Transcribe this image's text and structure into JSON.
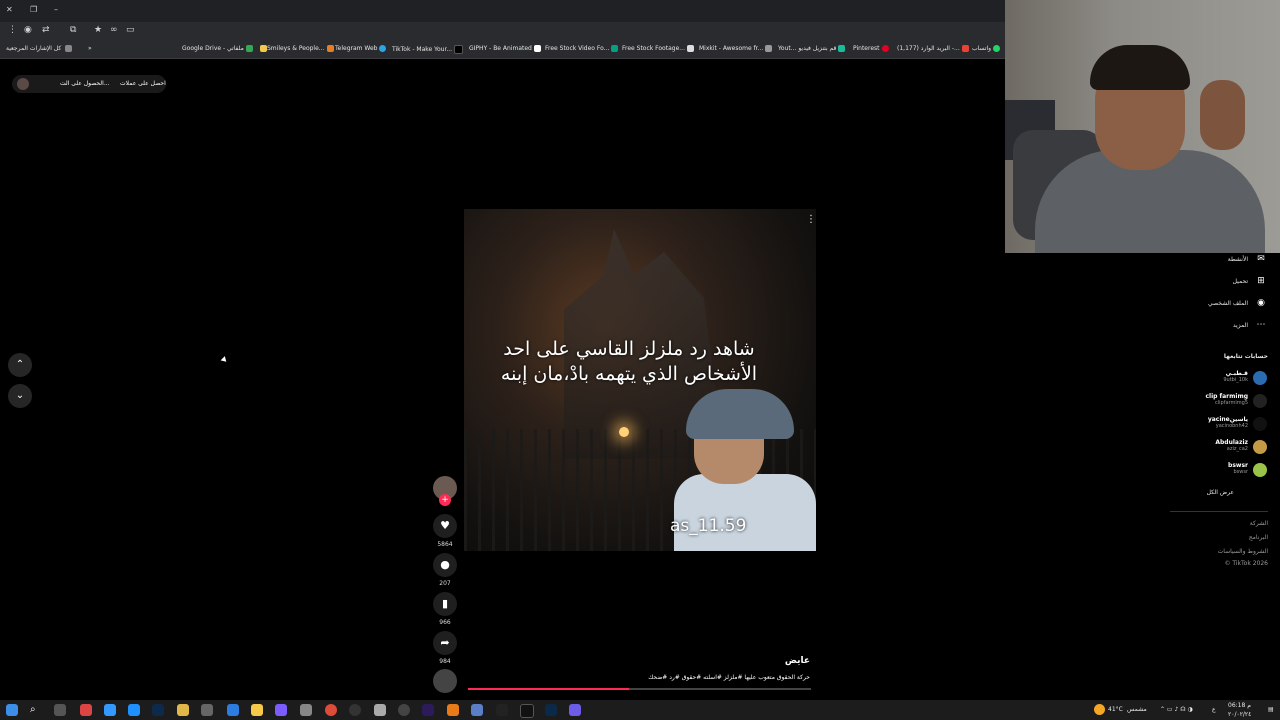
{
  "browser": {
    "bookmarks_all": "كل الإشارات المرجعية",
    "bookmarks": [
      "Google Drive - ملفاتي",
      "Smileys & People...",
      "Telegram Web",
      "TikTok - Make Your...",
      "GIPHY - Be Animated",
      "Free Stock Video Fo...",
      "Free Stock Footage...",
      "Mixkit - Awesome fr...",
      "Yout... قم بتنزيل فيديو",
      "Pinterest",
      "(1,177) البريد الوارد -...",
      "واتساب"
    ]
  },
  "promo": {
    "get_coins": "احصل على عملات",
    "get_app": "الحصول على الت..."
  },
  "video": {
    "overlay_text": "شاهد رد ملزلز القاسي على احد الأشخاص الذي يتهمه بادْ،مان إبنه",
    "tag": "as_11.59",
    "author": "عايض",
    "description": "حركة الحقوق متعوب عليها #ملزلز #اسلته #حقوق #رد #ضحك",
    "likes": "5864",
    "comments": "207",
    "saves": "966",
    "shares": "984",
    "progress": 0.47
  },
  "sidebar": {
    "activity": "الأنشطة",
    "upload": "تحميل",
    "profile": "الملف الشخصي",
    "more": "المزيد",
    "following_title": "حسابات تتابعها",
    "following": [
      {
        "name": "قـطبـي",
        "user": "9utbi_10k"
      },
      {
        "name": "clip farmimg",
        "user": "clipfarmimg5"
      },
      {
        "name": "yacineياسين",
        "user": "yacinobnh42"
      },
      {
        "name": "Abdulaziz",
        "user": "aziz_ca2"
      },
      {
        "name": "bswsr",
        "user": "bswsr"
      }
    ],
    "see_all": "عرض الكل",
    "footer": [
      "الشركة",
      "البرنامج",
      "الشروط والسياسات",
      "TikTok 2026 ©"
    ]
  },
  "taskbar": {
    "weather_temp": "41°C",
    "weather_desc": "مشمس",
    "time": "06:18 م",
    "date": "٢٠/٠٢/٢٤",
    "lang": "ع"
  },
  "colors": {
    "accent": "#fe2c55",
    "bg": "#000000"
  }
}
